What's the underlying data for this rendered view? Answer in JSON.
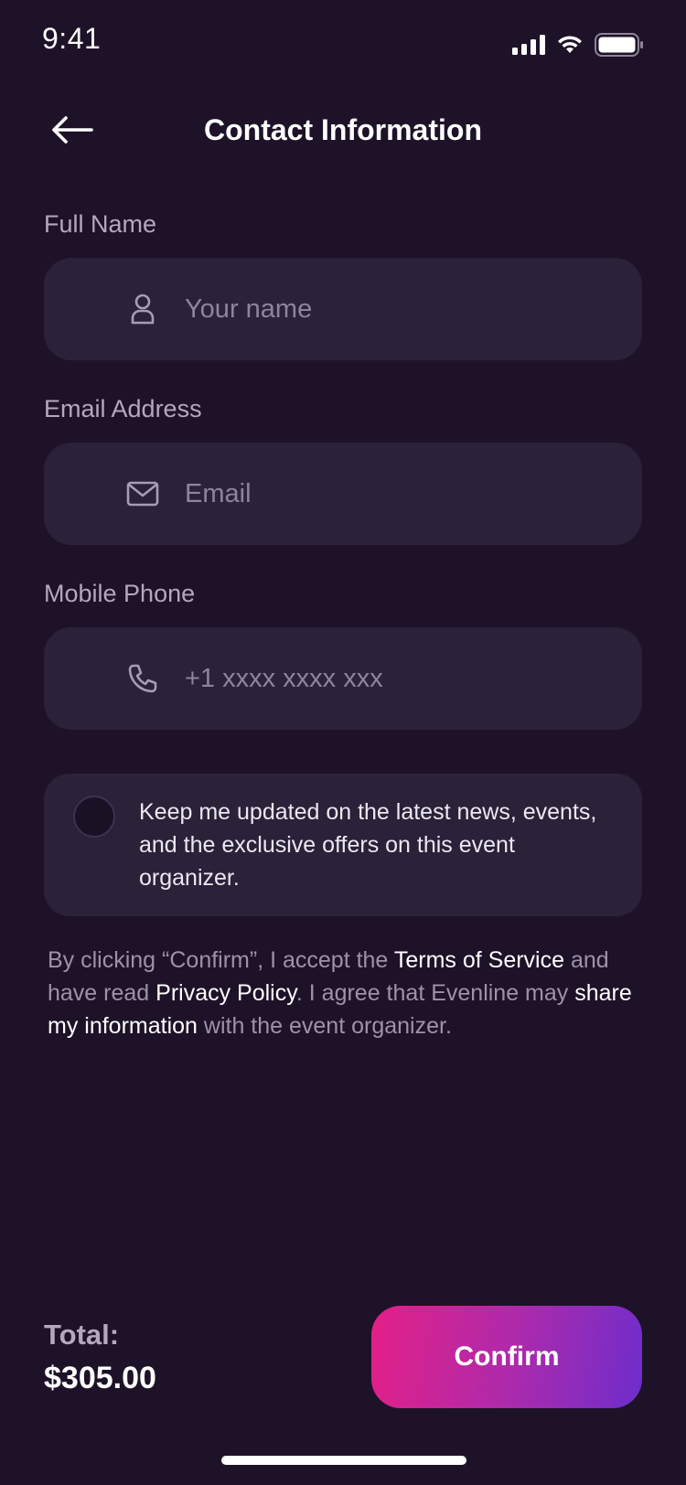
{
  "status_bar": {
    "time": "9:41",
    "icons": [
      "signal-icon",
      "wifi-icon",
      "battery-icon"
    ]
  },
  "header": {
    "back_icon": "arrow-left-icon",
    "title": "Contact Information"
  },
  "form": {
    "full_name": {
      "label": "Full Name",
      "placeholder": "Your name",
      "value": "",
      "icon": "user-icon"
    },
    "email": {
      "label": "Email Address",
      "placeholder": "Email",
      "value": "",
      "icon": "mail-icon"
    },
    "phone": {
      "label": "Mobile Phone",
      "placeholder": "+1 xxxx xxxx xxx",
      "value": "",
      "icon": "phone-icon"
    }
  },
  "consent": {
    "checked": false,
    "text": "Keep me updated on the latest news, events, and the exclusive offers on this event organizer."
  },
  "terms": {
    "part1": "By clicking “Confirm”, I accept the ",
    "tos_link": "Terms of Service",
    "part2": " and have read ",
    "privacy_link": "Privacy Policy",
    "part3": ". I agree that Evenline may ",
    "share_link": "share my information",
    "part4": " with the event organizer."
  },
  "footer": {
    "total_label": "Total:",
    "total_value": "$305.00",
    "confirm_label": "Confirm"
  },
  "colors": {
    "background": "#1e1228",
    "field_bg": "#2b2139",
    "label": "#b3a8bf",
    "gradient_start": "#e41f86",
    "gradient_end": "#6e2dcc"
  }
}
